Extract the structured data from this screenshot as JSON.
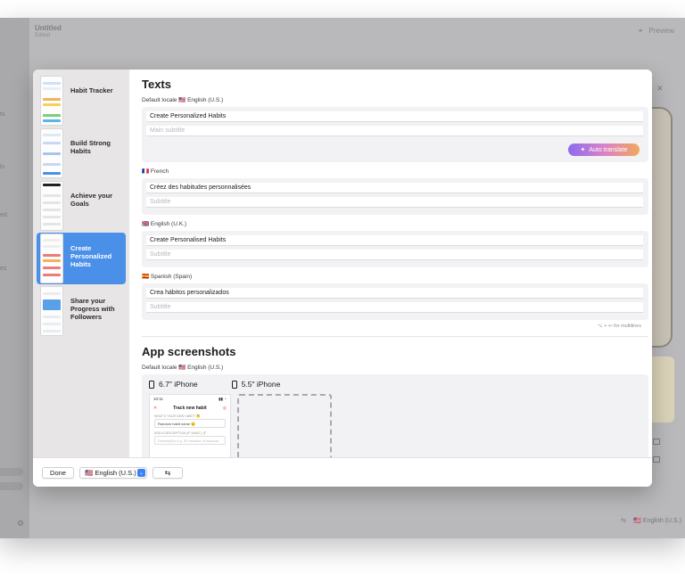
{
  "background": {
    "title": "Untitled",
    "subtitle": "Edited",
    "preview_label": "Preview",
    "side_labels": [
      "ts",
      "ls",
      "ed",
      "es"
    ],
    "bottom_locale": "🇺🇸 English (U.S.)"
  },
  "sidebar": {
    "items": [
      {
        "label": "Habit Tracker",
        "selected": false
      },
      {
        "label": "Build Strong Habits",
        "selected": false
      },
      {
        "label": "Achieve your Goals",
        "selected": false
      },
      {
        "label": "Create Personalized Habits",
        "selected": true
      },
      {
        "label": "Share your Progress with Followers",
        "selected": false
      }
    ]
  },
  "texts": {
    "title": "Texts",
    "default_locale_label": "Default locale 🇺🇸 English (U.S.)",
    "default": {
      "title_value": "Create Personalized Habits",
      "subtitle_placeholder": "Main subtitle",
      "auto_translate": "Auto translate"
    },
    "locales": [
      {
        "label": "🇫🇷 French",
        "title_value": "Créez des habitudes personnalisées",
        "subtitle_placeholder": "Subtitle"
      },
      {
        "label": "🇬🇧 English (U.K.)",
        "title_value": "Create Personalised Habits",
        "subtitle_placeholder": "Subtitle"
      },
      {
        "label": "🇪🇸 Spanish (Spain)",
        "title_value": "Crea hábitos personalizados",
        "subtitle_placeholder": "Subtitle"
      }
    ],
    "multiline_hint": "⌥ + ↩ for multilines"
  },
  "screenshots": {
    "title": "App screenshots",
    "default_locale_label": "Default locale 🇺🇸 English (U.S.)",
    "devices": [
      "6.7\" iPhone",
      "5.5\" iPhone"
    ],
    "preview": {
      "time": "10:11",
      "nav_title": "Track new habit",
      "name_label": "WHAT'S YOUR NEW HABIT? 🤔",
      "name_value": "Random habit name 😊",
      "desc_label": "ADD A DESCRIPTION (IF WANT) 📝",
      "desc_placeholder": "Description e.g. 30 minutes of workout"
    }
  },
  "footer": {
    "done": "Done",
    "locale": "🇺🇸 English (U.S.)",
    "translate_icon": "translate-icon"
  },
  "colors": {
    "accent": "#4a90e8",
    "auto_translate_start": "#8a6cf0",
    "auto_translate_end": "#f0a85a"
  }
}
